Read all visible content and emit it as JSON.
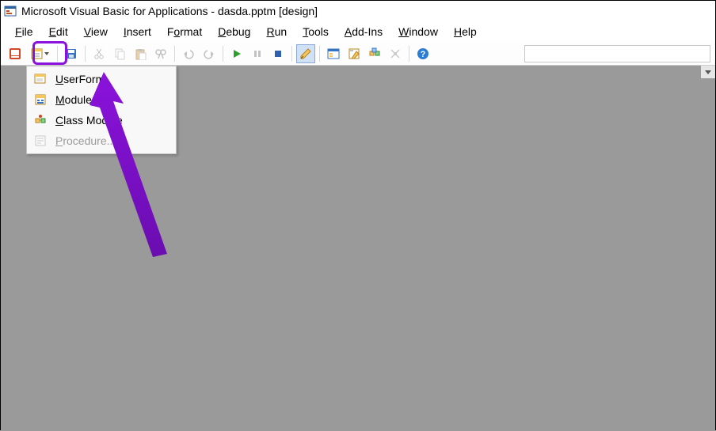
{
  "title": "Microsoft Visual Basic for Applications - dasda.pptm [design]",
  "menubar": [
    {
      "pre": "",
      "u": "F",
      "post": "ile"
    },
    {
      "pre": "",
      "u": "E",
      "post": "dit"
    },
    {
      "pre": "",
      "u": "V",
      "post": "iew"
    },
    {
      "pre": "",
      "u": "I",
      "post": "nsert"
    },
    {
      "pre": "F",
      "u": "o",
      "post": "rmat"
    },
    {
      "pre": "",
      "u": "D",
      "post": "ebug"
    },
    {
      "pre": "",
      "u": "R",
      "post": "un"
    },
    {
      "pre": "",
      "u": "T",
      "post": "ools"
    },
    {
      "pre": "",
      "u": "A",
      "post": "dd-Ins"
    },
    {
      "pre": "",
      "u": "W",
      "post": "indow"
    },
    {
      "pre": "",
      "u": "H",
      "post": "elp"
    }
  ],
  "dropdown": {
    "items": [
      {
        "icon": "userform",
        "pre": "",
        "u": "U",
        "post": "serForm",
        "enabled": true
      },
      {
        "icon": "module",
        "pre": "",
        "u": "M",
        "post": "odule",
        "enabled": true
      },
      {
        "icon": "classmodule",
        "pre": "",
        "u": "C",
        "post": "lass Module",
        "enabled": true
      },
      {
        "icon": "procedure",
        "pre": "",
        "u": "P",
        "post": "rocedure...",
        "enabled": false
      }
    ]
  },
  "toolbar_desc": {
    "buttons": [
      "view-powerpoint",
      "insert-split",
      "sep",
      "save",
      "sep",
      "cut",
      "copy",
      "paste",
      "find",
      "sep",
      "undo",
      "redo",
      "sep",
      "run",
      "break",
      "reset",
      "sep",
      "design-mode-checked",
      "sep",
      "project-explorer",
      "properties",
      "object-browser",
      "toolbox",
      "sep",
      "help"
    ]
  },
  "colors": {
    "highlight": "#8b12dc",
    "workspace": "#9a9a9a"
  }
}
